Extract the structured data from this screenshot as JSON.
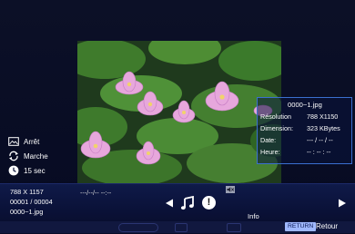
{
  "photo_panel": {
    "file_name": "0000~1.jpg",
    "rows": [
      {
        "key": "Résolution",
        "value": "788 X1150"
      },
      {
        "key": "Dimension:",
        "value": "323 KBytes"
      },
      {
        "key": "Date:",
        "value": "--- / -- / --"
      },
      {
        "key": "Heure:",
        "value": "-- : -- : --"
      }
    ]
  },
  "side_controls": {
    "stop_label": "Arrêt",
    "walk_label": "Marche",
    "interval_label": "15 sec"
  },
  "left_info": {
    "resolution": "788 X 1157",
    "counter": "00001 / 00004",
    "file_name": "0000~1.jpg"
  },
  "time_code": "---/--/--  --:--",
  "bottom_bar": {
    "info_label": "Info",
    "return_key": "RETURN",
    "return_label": "Retour"
  },
  "icons": [
    "picture-icon",
    "repeat-icon",
    "clock-icon",
    "mute-icon",
    "prev-icon",
    "music-icon",
    "info-icon",
    "next-icon"
  ]
}
